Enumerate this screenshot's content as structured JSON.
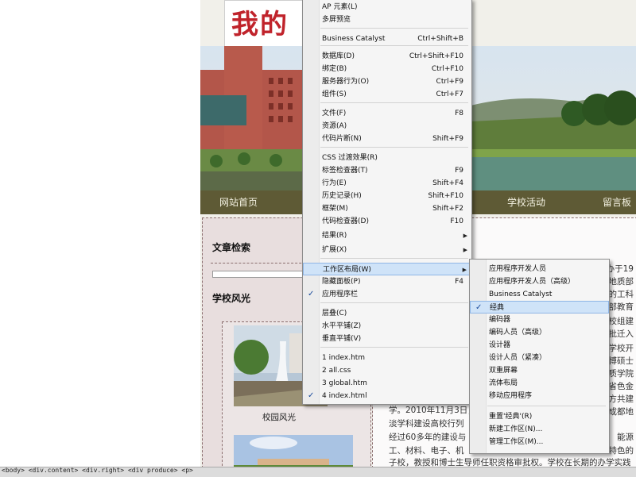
{
  "page": {
    "logo_text": "我的",
    "nav": [
      "网站首页",
      "学校活动",
      "留言板"
    ],
    "sidebar": {
      "search_heading": "文章检索",
      "scenery_heading": "学校风光",
      "photo_caption": "校园风光"
    },
    "article": {
      "edge_fragments": [
        "办于19",
        "地质部",
        "的工科",
        "部教育",
        "校组建",
        "批迁入",
        "学校开",
        "博硕士",
        "质学院",
        "省色金",
        "方共建",
        "成都地"
      ],
      "lines": [
        "学。2010年11月3日，",
        "淡学科建设高校行列",
        "经过60多年的建设与",
        "工、材料、电子、机",
        "子校，教授和博士生导师任职资格审批权。学校在长期的办学实践"
      ],
      "line_suffix": [
        "能源",
        "特色的"
      ]
    }
  },
  "status_bar": {
    "tag_path": "<body> <div.content> <div.right> <div produce> <p>"
  },
  "window_menu": {
    "items": [
      {
        "label": "AP 元素(L)",
        "shortcut": ""
      },
      {
        "label": "多屏预览",
        "shortcut": ""
      },
      {
        "label": "Business Catalyst",
        "shortcut": "Ctrl+Shift+B"
      },
      {
        "label": "数据库(D)",
        "shortcut": "Ctrl+Shift+F10"
      },
      {
        "label": "绑定(B)",
        "shortcut": "Ctrl+F10"
      },
      {
        "label": "服务器行为(O)",
        "shortcut": "Ctrl+F9"
      },
      {
        "label": "组件(S)",
        "shortcut": "Ctrl+F7"
      },
      {
        "label": "文件(F)",
        "shortcut": "F8"
      },
      {
        "label": "资源(A)",
        "shortcut": ""
      },
      {
        "label": "代码片断(N)",
        "shortcut": "Shift+F9"
      },
      {
        "label": "CSS 过渡效果(R)",
        "shortcut": ""
      },
      {
        "label": "标签检查器(T)",
        "shortcut": "F9"
      },
      {
        "label": "行为(E)",
        "shortcut": "Shift+F4"
      },
      {
        "label": "历史记录(H)",
        "shortcut": "Shift+F10"
      },
      {
        "label": "框架(M)",
        "shortcut": "Shift+F2"
      },
      {
        "label": "代码检查器(D)",
        "shortcut": "F10"
      },
      {
        "label": "结果(R)",
        "shortcut": ""
      },
      {
        "label": "扩展(X)",
        "shortcut": ""
      },
      {
        "label": "工作区布局(W)",
        "shortcut": ""
      },
      {
        "label": "隐藏面板(P)",
        "shortcut": "F4"
      },
      {
        "label": "应用程序栏",
        "shortcut": ""
      },
      {
        "label": "层叠(C)",
        "shortcut": ""
      },
      {
        "label": "水平平铺(Z)",
        "shortcut": ""
      },
      {
        "label": "垂直平铺(V)",
        "shortcut": ""
      },
      {
        "label": "1 index.htm",
        "shortcut": ""
      },
      {
        "label": "2 all.css",
        "shortcut": ""
      },
      {
        "label": "3 global.htm",
        "shortcut": ""
      },
      {
        "label": "4 index.html",
        "shortcut": ""
      }
    ]
  },
  "workspace_menu": {
    "items": [
      {
        "label": "应用程序开发人员"
      },
      {
        "label": "应用程序开发人员（高级）"
      },
      {
        "label": "Business Catalyst"
      },
      {
        "label": "经典"
      },
      {
        "label": "编码器"
      },
      {
        "label": "编码人员（高级）"
      },
      {
        "label": "设计器"
      },
      {
        "label": "设计人员（紧凑）"
      },
      {
        "label": "双重屏幕"
      },
      {
        "label": "流体布局"
      },
      {
        "label": "移动应用程序"
      },
      {
        "label": "重置'经典'(R)"
      },
      {
        "label": "新建工作区(N)..."
      },
      {
        "label": "管理工作区(M)..."
      }
    ]
  },
  "glyphs": {
    "check": "✓",
    "submenu": "▶"
  },
  "colors": {
    "nav_bg": "#5e5a35",
    "menu_highlight": "#cfe3f8",
    "logo_red": "#c0232b"
  }
}
